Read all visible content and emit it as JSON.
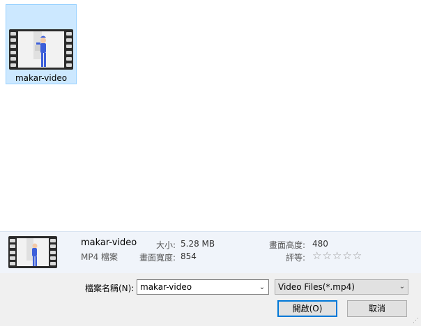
{
  "file": {
    "name": "makar-video",
    "type_label": "MP4 檔案"
  },
  "details": {
    "size_label": "大小:",
    "size_value": "5.28 MB",
    "width_label": "畫面寬度:",
    "width_value": "854",
    "height_label": "畫面高度:",
    "height_value": "480",
    "rating_label": "評等:",
    "rating_stars": "☆☆☆☆☆",
    "rating_value": 0
  },
  "bottom": {
    "filename_label": "檔案名稱(N):",
    "filename_value": "makar-video",
    "filetype_value": "Video Files(*.mp4)",
    "open_label": "開啟(O)",
    "cancel_label": "取消"
  },
  "colors": {
    "selection": "#cce8ff",
    "accent": "#0078d7"
  }
}
